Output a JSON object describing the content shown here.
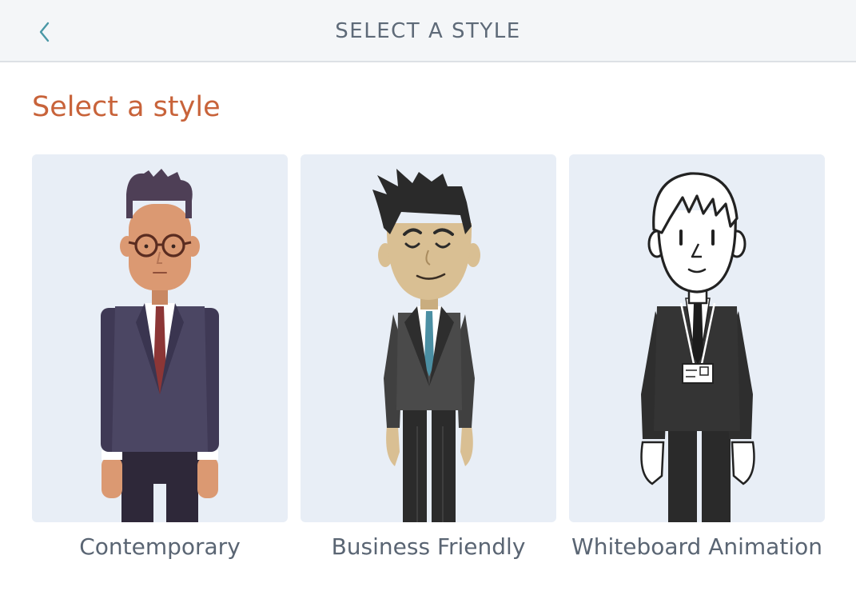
{
  "header": {
    "title": "SELECT A STYLE",
    "back_icon": "chevron-left-icon"
  },
  "main": {
    "title": "Select a style",
    "styles": [
      {
        "label": "Contemporary",
        "illustration": "contemporary-character"
      },
      {
        "label": "Business Friendly",
        "illustration": "business-friendly-character"
      },
      {
        "label": "Whiteboard Animation",
        "illustration": "whiteboard-character"
      }
    ]
  },
  "colors": {
    "accent": "#c8633a",
    "header_bg": "#f4f6f8",
    "card_bg": "#e8eef6",
    "text": "#5e6a78",
    "back_icon": "#4a98a6"
  }
}
